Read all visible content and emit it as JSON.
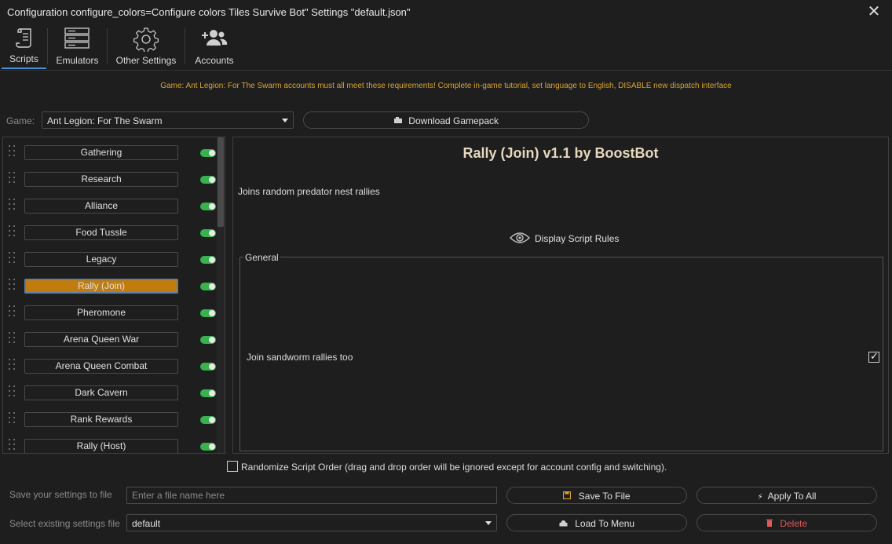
{
  "window": {
    "title": "Configuration configure_colors=Configure colors Tiles Survive Bot\" Settings \"default.json\"",
    "close_glyph": "✕"
  },
  "tabs": [
    {
      "label": "Scripts",
      "icon": "scroll-icon",
      "active": true
    },
    {
      "label": "Emulators",
      "icon": "server-icon",
      "active": false
    },
    {
      "label": "Other Settings",
      "icon": "gear-icon",
      "active": false
    },
    {
      "label": "Accounts",
      "icon": "users-add-icon",
      "active": false
    }
  ],
  "warning": "Game: Ant Legion: For The Swarm accounts must all meet these requirements! Complete in-game tutorial, set language to English, DISABLE new dispatch interface",
  "game": {
    "label": "Game:",
    "selected": "Ant Legion: For The Swarm",
    "download_label": "Download Gamepack"
  },
  "scripts": [
    {
      "label": "Gathering",
      "enabled": true,
      "selected": false
    },
    {
      "label": "Research",
      "enabled": true,
      "selected": false
    },
    {
      "label": "Alliance",
      "enabled": true,
      "selected": false
    },
    {
      "label": "Food Tussle",
      "enabled": true,
      "selected": false
    },
    {
      "label": "Legacy",
      "enabled": true,
      "selected": false
    },
    {
      "label": "Rally (Join)",
      "enabled": true,
      "selected": true
    },
    {
      "label": "Pheromone",
      "enabled": true,
      "selected": false
    },
    {
      "label": "Arena Queen War",
      "enabled": true,
      "selected": false
    },
    {
      "label": "Arena Queen Combat",
      "enabled": true,
      "selected": false
    },
    {
      "label": "Dark Cavern",
      "enabled": true,
      "selected": false
    },
    {
      "label": "Rank Rewards",
      "enabled": true,
      "selected": false
    },
    {
      "label": "Rally (Host)",
      "enabled": true,
      "selected": false
    }
  ],
  "detail": {
    "title": "Rally (Join) v1.1 by BoostBot",
    "description": "Joins random predator nest rallies",
    "rules_label": "Display Script Rules",
    "group_title": "General",
    "option_label": "Join sandworm rallies too",
    "option_checked": true
  },
  "randomize": {
    "label": "Randomize Script Order (drag and drop order will be ignored except for account config and switching).",
    "checked": false
  },
  "save": {
    "label": "Save your settings to file",
    "placeholder": "Enter a file name here",
    "value": "",
    "save_button": "Save To File",
    "apply_button": "Apply To All"
  },
  "load": {
    "label": "Select existing settings file",
    "selected": "default",
    "load_button": "Load To Menu",
    "delete_button": "Delete"
  },
  "colors": {
    "background": "#1e1e1e",
    "accent_selected": "#c27c0e",
    "toggle_on": "#37b24d",
    "warning": "#d9a431",
    "delete_text": "#e05a5a",
    "title_text": "#e6d7bd",
    "tab_underline": "#4a90d9"
  }
}
